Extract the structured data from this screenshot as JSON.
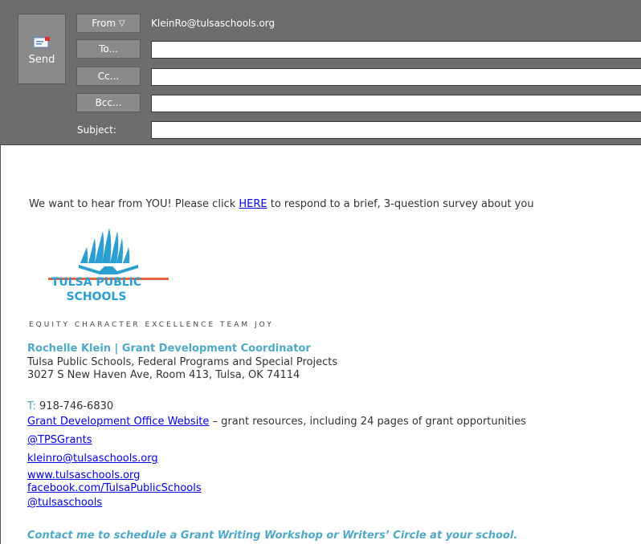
{
  "header": {
    "send_label": "Send",
    "from_label": "From",
    "from_address": "KleinRo@tulsaschools.org",
    "to_label": "To...",
    "cc_label": "Cc...",
    "bcc_label": "Bcc...",
    "subject_label": "Subject:",
    "to_value": "",
    "cc_value": "",
    "bcc_value": "",
    "subject_value": ""
  },
  "body": {
    "intro_before": "We want to hear from YOU!  Please click ",
    "intro_link": "HERE",
    "intro_after": " to respond to a brief, 3-question survey about you",
    "logo_line1": "TULSA PUBLIC",
    "logo_line2": "SCHOOLS",
    "values_tagline": "EQUITY   CHARACTER   EXCELLENCE   TEAM   JOY",
    "signature": {
      "name_title": "Rochelle Klein | Grant Development Coordinator",
      "org": "Tulsa Public Schools,  Federal Programs and Special Projects",
      "address": "3027 S New Haven Ave, Room 413, Tulsa, OK 74114",
      "phone_label": "T:",
      "phone": " 918-746-6830",
      "website_link": "Grant Development Office Website",
      "website_desc": " – grant resources, including 24 pages of grant opportunities",
      "twitter": "@TPSGrants",
      "email": "kleinro@tulsaschools.org",
      "url": "www.tulsaschools.org",
      "facebook": "facebook.com/TulsaPublicSchools",
      "instagram": "@tulsaschools",
      "contact_note": "Contact me to schedule a Grant Writing Workshop or Writers’ Circle at your school."
    }
  },
  "colors": {
    "header_bg": "#6d6d6d",
    "brand_blue": "#2b9ed2",
    "signature_blue": "#4fa8c8",
    "logo_underline": "#e8643c",
    "link": "#0000ee"
  }
}
